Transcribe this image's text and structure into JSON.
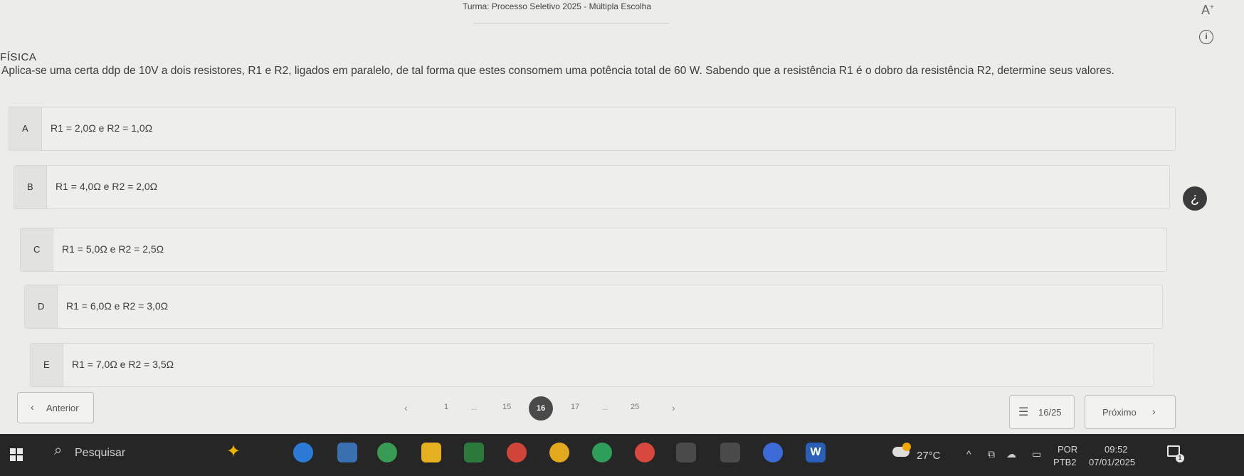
{
  "header": {
    "title": "Turma: Processo Seletivo 2025 - Múltipla Escolha",
    "font_size_button": "A",
    "font_size_sup": "+",
    "info": "i"
  },
  "question": {
    "subject": "FÍSICA",
    "text": "Aplica-se uma certa ddp de 10V a dois resistores, R1 e R2, ligados em paralelo, de tal forma que estes consomem uma potência total de 60 W. Sabendo que a resistência R1 é o dobro da resistência R2, determine seus valores."
  },
  "options": [
    {
      "letter": "A",
      "text": "R1 = 2,0Ω e R2 = 1,0Ω"
    },
    {
      "letter": "B",
      "text": "R1 = 4,0Ω e R2 = 2,0Ω"
    },
    {
      "letter": "C",
      "text": "R1 = 5,0Ω e R2 = 2,5Ω"
    },
    {
      "letter": "D",
      "text": "R1 = 6,0Ω e R2 = 3,0Ω"
    },
    {
      "letter": "E",
      "text": "R1 = 7,0Ω e R2 = 3,5Ω"
    }
  ],
  "navigation": {
    "prev_chevron": "‹",
    "prev_label": "Anterior",
    "pager_prev": "‹",
    "pager_next": "›",
    "pages": [
      "1",
      "15",
      "16",
      "17",
      "25"
    ],
    "current_page": "16",
    "ellipsis": "...",
    "progress": "16/25",
    "list_icon": "☰",
    "next_label": "Próximo",
    "next_chevron": "›"
  },
  "taskbar": {
    "search_label": "Pesquisar",
    "temperature": "27°C",
    "language": "POR",
    "keyboard": "PTB2",
    "time": "09:52",
    "date": "07/01/2025",
    "notification_count": "1",
    "word_label": "W"
  },
  "icons": {
    "search": "search-icon",
    "info": "info-icon",
    "windows": "windows-start-icon"
  }
}
